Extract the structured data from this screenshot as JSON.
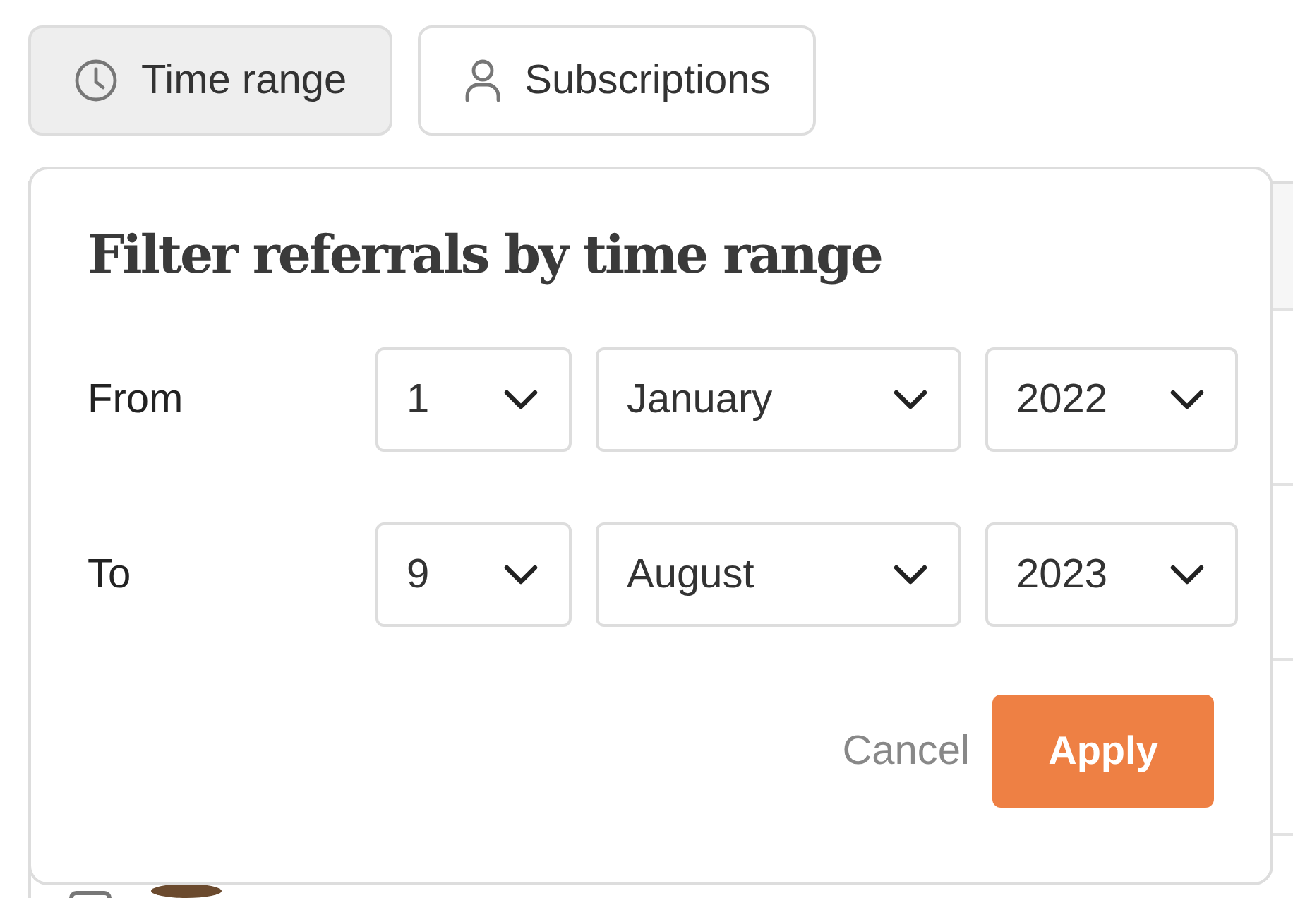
{
  "filters": [
    {
      "label": "Time range",
      "kind": "clock",
      "selected": true
    },
    {
      "label": "Subscriptions",
      "kind": "person",
      "selected": false
    }
  ],
  "table": {
    "rows": [
      {
        "checked": false
      }
    ]
  },
  "popover": {
    "title": "Filter referrals by time range",
    "rows": [
      {
        "label": "From",
        "fields": [
          {
            "value": "1"
          },
          {
            "value": "January"
          },
          {
            "value": "2022"
          }
        ]
      },
      {
        "label": "To",
        "fields": [
          {
            "value": "9"
          },
          {
            "value": "August"
          },
          {
            "value": "2023"
          }
        ]
      }
    ],
    "cancel": "Cancel",
    "apply": "Apply"
  }
}
